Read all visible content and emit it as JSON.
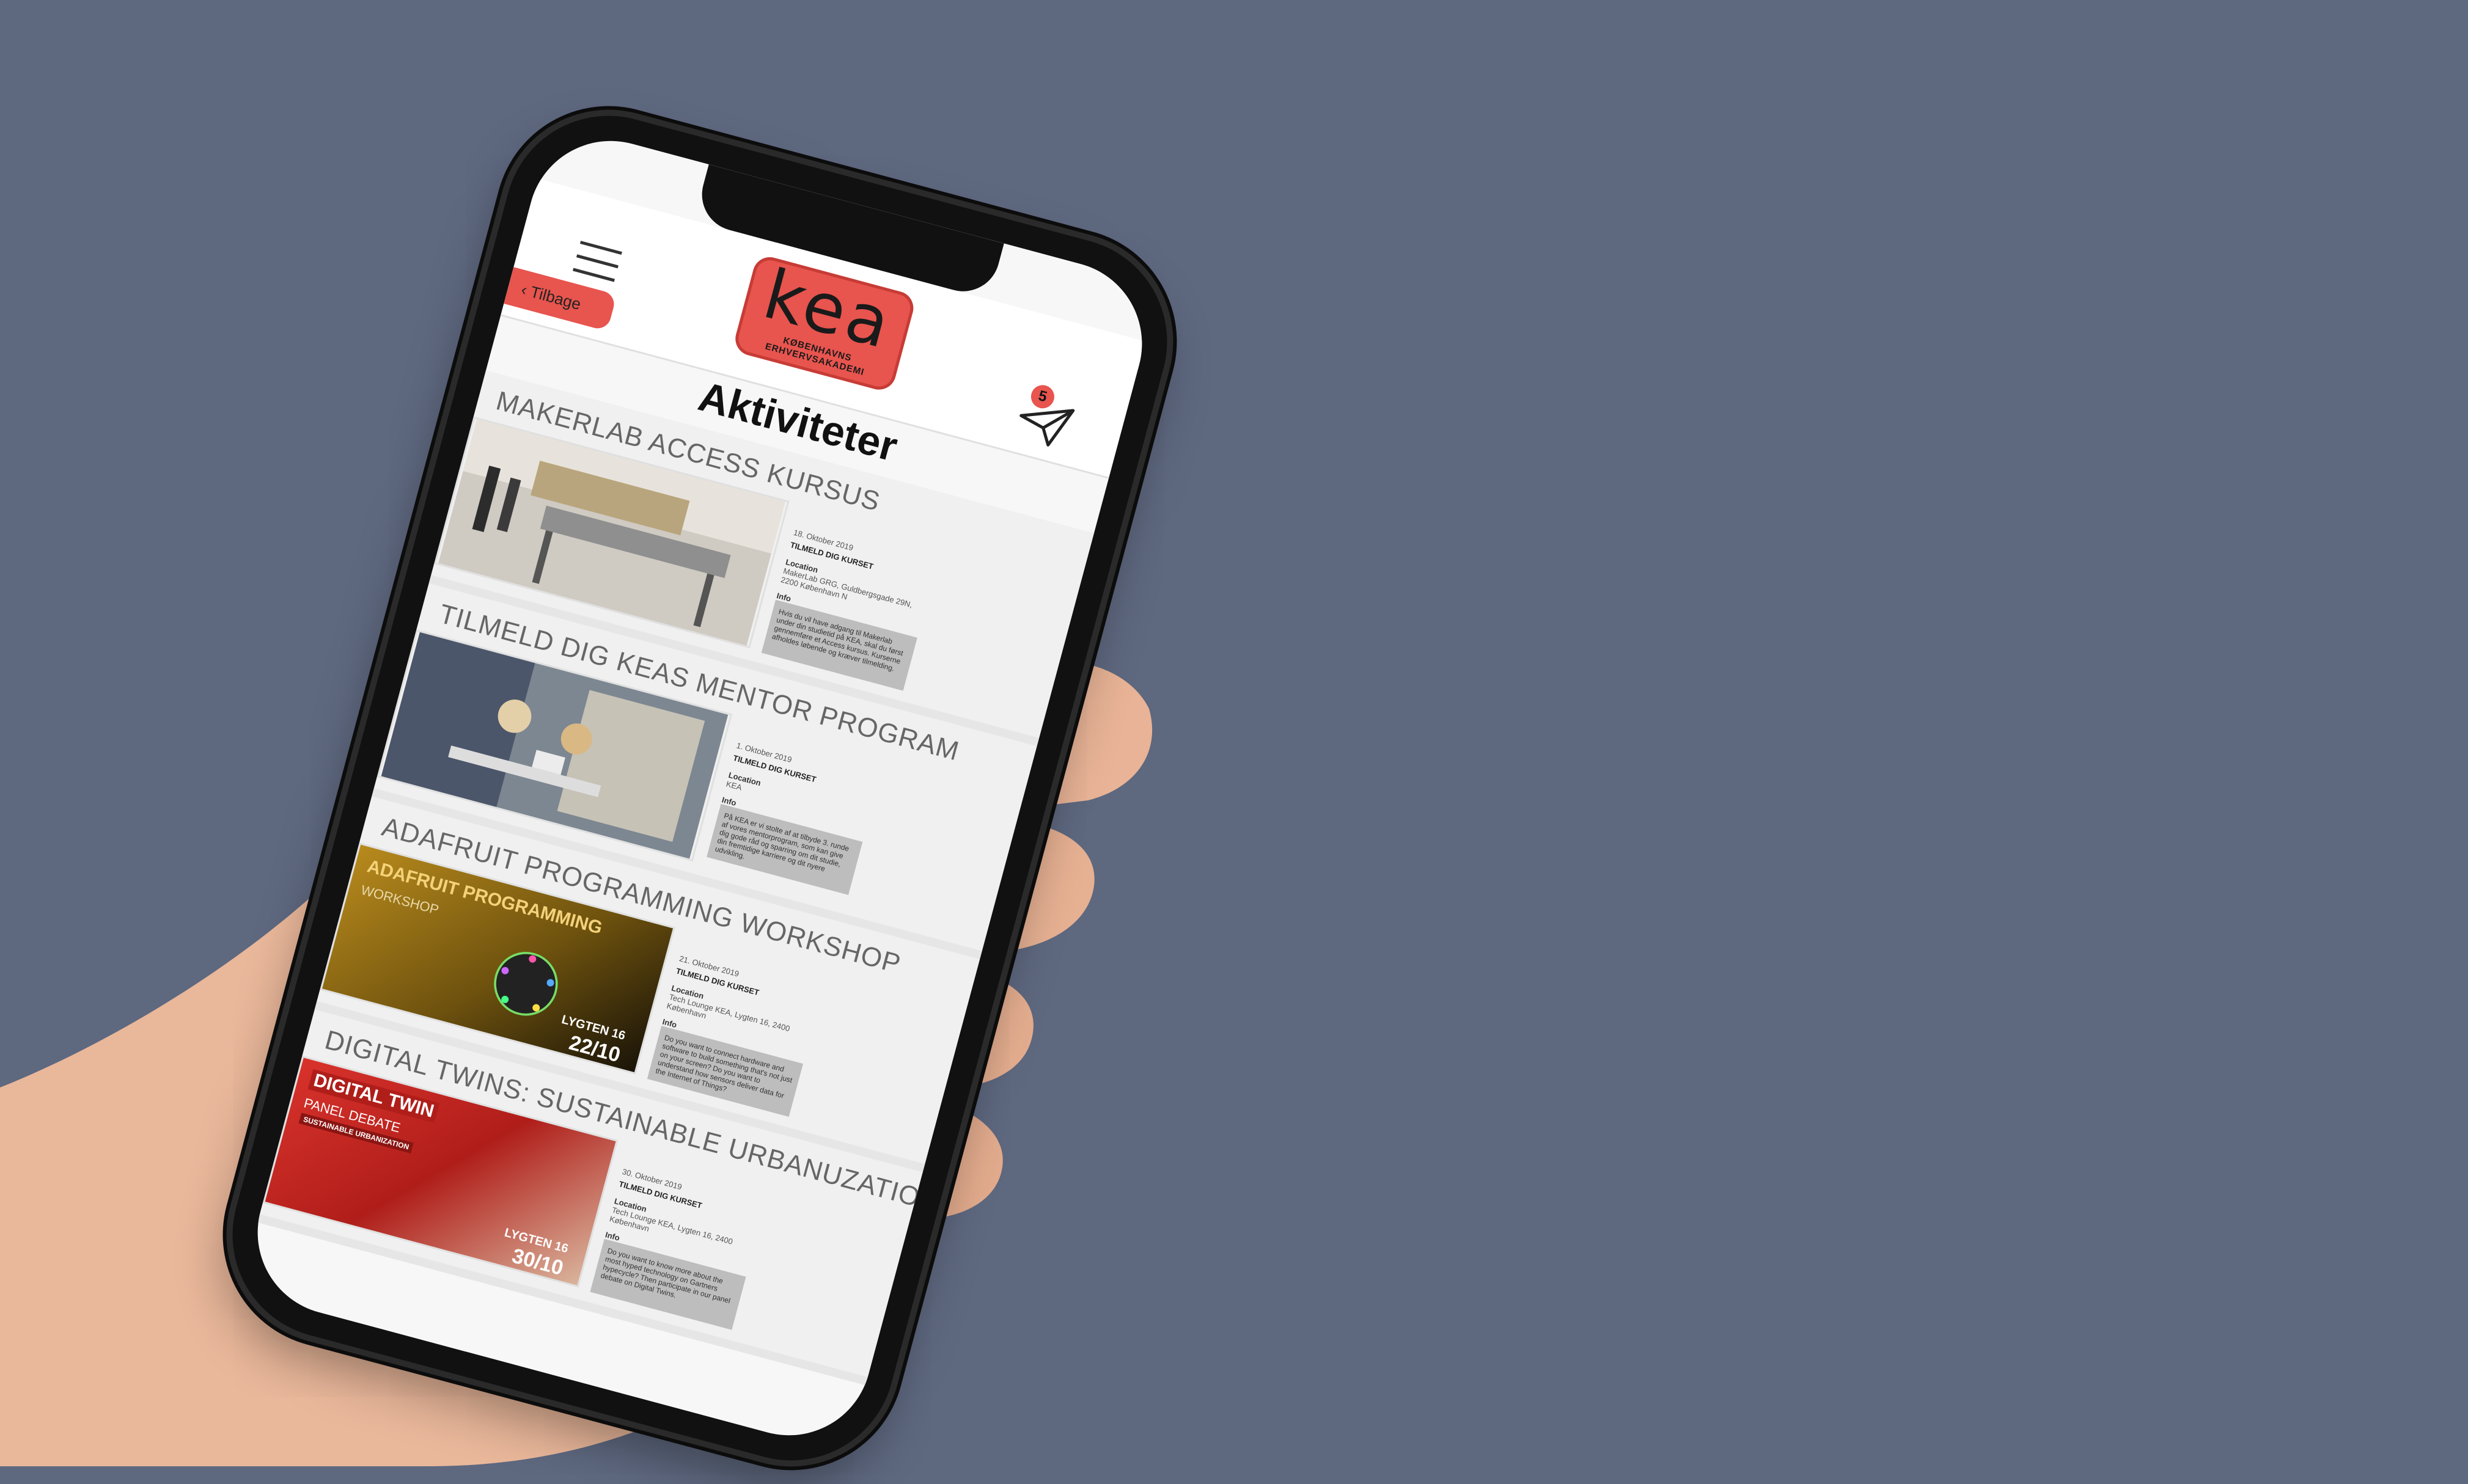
{
  "app": {
    "logo_text": "kea",
    "logo_subtitle": "KØBENHAVNS ERHVERVSAKADEMI",
    "back_label": "Tilbage",
    "notification_count": "5",
    "page_title": "Aktiviteter"
  },
  "activities": [
    {
      "title": "MAKERLAB ACCESS KURSUS",
      "date": "18. Oktober 2019",
      "signup": "TILMELD DIG KURSET",
      "location_label": "Location",
      "location": "MakerLab GRG, Guldbergsgade 29N, 2200 København N",
      "info_label": "Info",
      "info": "Hvis du vil have adgang til Makerlab under din studietid på KEA, skal du først gennemføre et Access kursus. Kurserne afholdes løbende og kræver tilmelding."
    },
    {
      "title": "TILMELD DIG KEAS MENTOR PROGRAM",
      "date": "1. Oktober 2019",
      "signup": "TILMELD DIG KURSET",
      "location_label": "Location",
      "location": "KEA",
      "info_label": "Info",
      "info": "På KEA er vi stolte af at tilbyde 3. runde af vores mentorprogram, som kan give dig gode råd og sparring om dit studie, din fremtidige karriere og dit nyere udvikling."
    },
    {
      "title": "ADAFRUIT PROGRAMMING WORKSHOP",
      "date": "21. Oktober 2019",
      "signup": "TILMELD DIG KURSET",
      "location_label": "Location",
      "location": "Tech Lounge KEA, Lygten 16, 2400 København",
      "info_label": "Info",
      "info": "Do you want to connect hardware and software to build something that's not just on your screen? Do you want to understand how sensors deliver data for the Internet of Things?",
      "banner_title": "ADAFRUIT PROGRAMMING",
      "banner_sub": "WORKSHOP",
      "banner_place": "LYGTEN 16",
      "banner_date": "22/10"
    },
    {
      "title": "DIGITAL TWINS: SUSTAINABLE URBANUZATION",
      "date": "30. Oktober 2019",
      "signup": "TILMELD DIG KURSET",
      "location_label": "Location",
      "location": "Tech Lounge KEA, Lygten 16, 2400 København",
      "info_label": "Info",
      "info": "Do you want to know more about the most hyped technology on Gartners hypecycle? Then participate in our panel debate on Digital Twins.",
      "banner_title": "DIGITAL TWIN",
      "banner_sub": "PANEL DEBATE",
      "banner_tag": "SUSTAINABLE URBANIZATION",
      "banner_place": "LYGTEN 16",
      "banner_date": "30/10"
    }
  ],
  "colors": {
    "background": "#5e687f",
    "brand": "#e8544e"
  }
}
